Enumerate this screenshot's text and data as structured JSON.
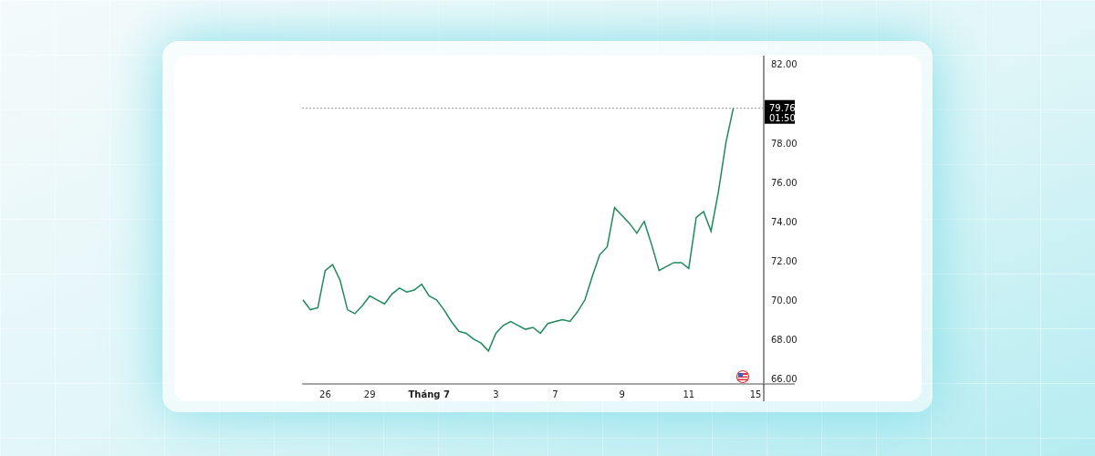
{
  "chart": {
    "chart_data": {
      "type": "line",
      "categories": [
        null,
        null,
        null,
        "26",
        null,
        null,
        null,
        null,
        null,
        "29",
        null,
        null,
        null,
        null,
        null,
        null,
        null,
        "Tháng 7",
        null,
        null,
        null,
        null,
        null,
        null,
        null,
        null,
        "3",
        null,
        null,
        null,
        null,
        null,
        null,
        null,
        "7",
        null,
        null,
        null,
        null,
        null,
        null,
        null,
        null,
        "9",
        null,
        null,
        null,
        null,
        null,
        null,
        null,
        null,
        "11",
        null,
        null,
        null,
        null,
        null,
        null,
        null,
        null,
        "15"
      ],
      "series": [
        {
          "color": "#1e8a5a",
          "values": [
            70.0,
            69.5,
            69.6,
            71.5,
            71.8,
            71.0,
            69.5,
            69.3,
            69.7,
            70.2,
            70.0,
            69.8,
            70.3,
            70.6,
            70.4,
            70.5,
            70.8,
            70.2,
            70.0,
            69.5,
            68.9,
            68.4,
            68.3,
            68.0,
            67.8,
            67.4,
            68.3,
            68.7,
            68.9,
            68.7,
            68.5,
            68.6,
            68.3,
            68.8,
            68.9,
            69.0,
            68.9,
            69.4,
            70.0,
            71.2,
            72.3,
            72.7,
            74.7,
            74.3,
            73.9,
            73.4,
            74.0,
            72.8,
            71.5,
            71.7,
            71.9,
            71.9,
            71.6,
            74.2,
            74.5,
            73.5,
            75.5,
            78.0,
            79.76,
            null,
            null,
            null
          ]
        }
      ],
      "ylim": [
        65.72,
        82.44
      ],
      "ref_lines": [
        {
          "axis": "y",
          "value": 79.76,
          "label": "79.76"
        }
      ],
      "yticks": [
        {
          "value": 66,
          "label": "66.00"
        },
        {
          "value": 68,
          "label": "68.00"
        },
        {
          "value": 70,
          "label": "70.00"
        },
        {
          "value": 72,
          "label": "72.00"
        },
        {
          "value": 74,
          "label": "74.00"
        },
        {
          "value": 76,
          "label": "76.00"
        },
        {
          "value": 78,
          "label": "78.00"
        },
        {
          "value": 82,
          "label": "82.00"
        }
      ]
    },
    "last_price": {
      "countdown": "01:50"
    }
  }
}
